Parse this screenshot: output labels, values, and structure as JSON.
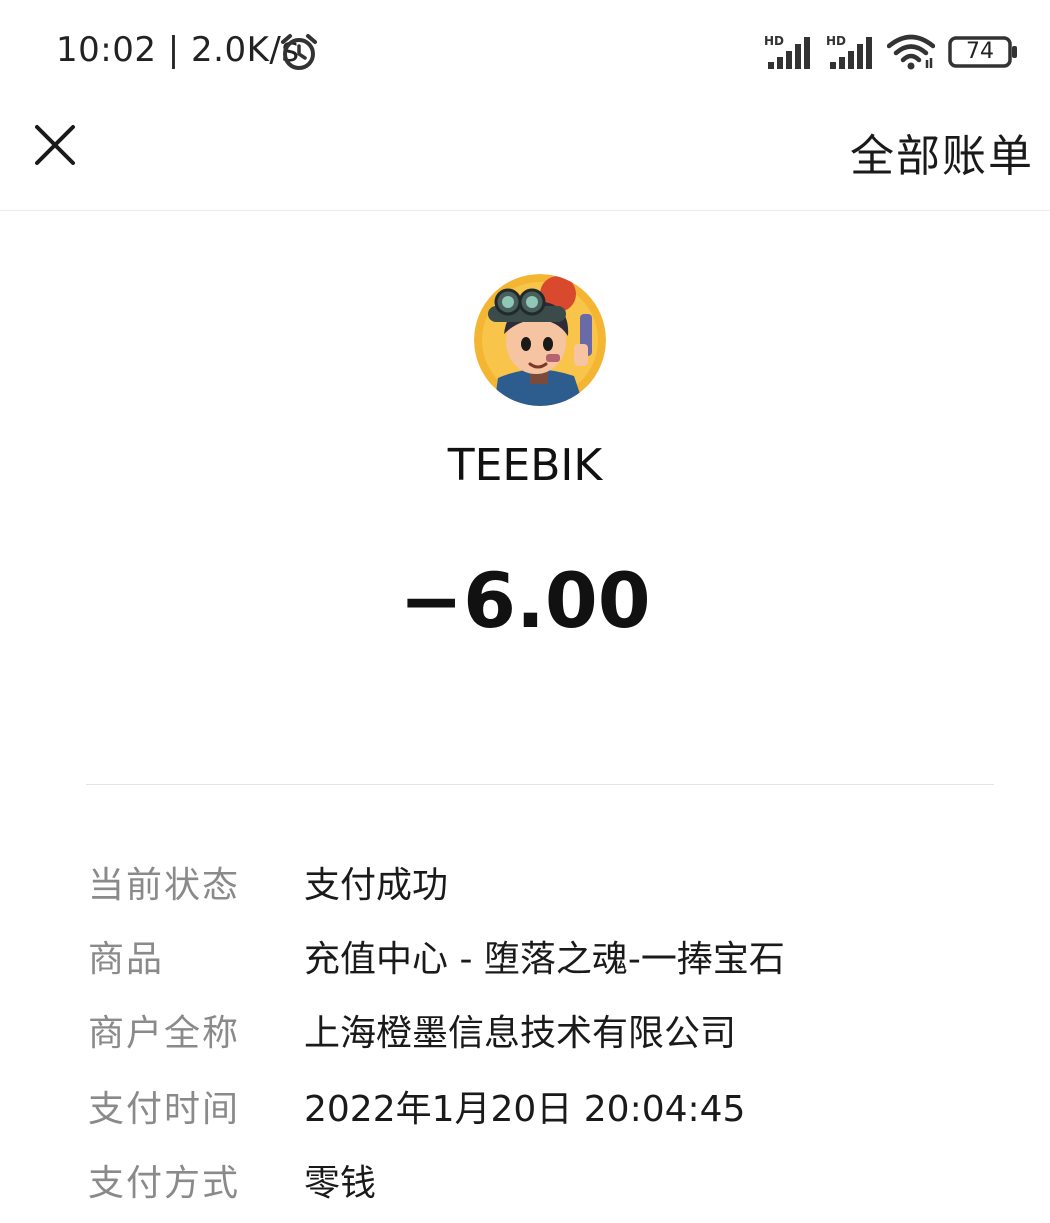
{
  "status_bar": {
    "time_speed": "10:02 | 2.0K/s",
    "signal_1_label": "HD",
    "signal_2_label": "HD",
    "battery": "74"
  },
  "nav": {
    "close_icon": "close-icon",
    "all_bills": "全部账单"
  },
  "merchant": {
    "name": "TEEBIK",
    "amount": "−6.00"
  },
  "details": [
    {
      "label": "当前状态",
      "value": "支付成功"
    },
    {
      "label": "商品",
      "value": "充值中心 - 堕落之魂-一捧宝石"
    },
    {
      "label": "商户全称",
      "value": "上海橙墨信息技术有限公司"
    },
    {
      "label": "支付时间",
      "value": "2022年1月20日 20:04:45"
    },
    {
      "label": "支付方式",
      "value": "零钱"
    }
  ],
  "colors": {
    "label_gray": "#8a8a8a",
    "text_dark": "#1a1a1a",
    "avatar_bg": "#f4b533"
  }
}
